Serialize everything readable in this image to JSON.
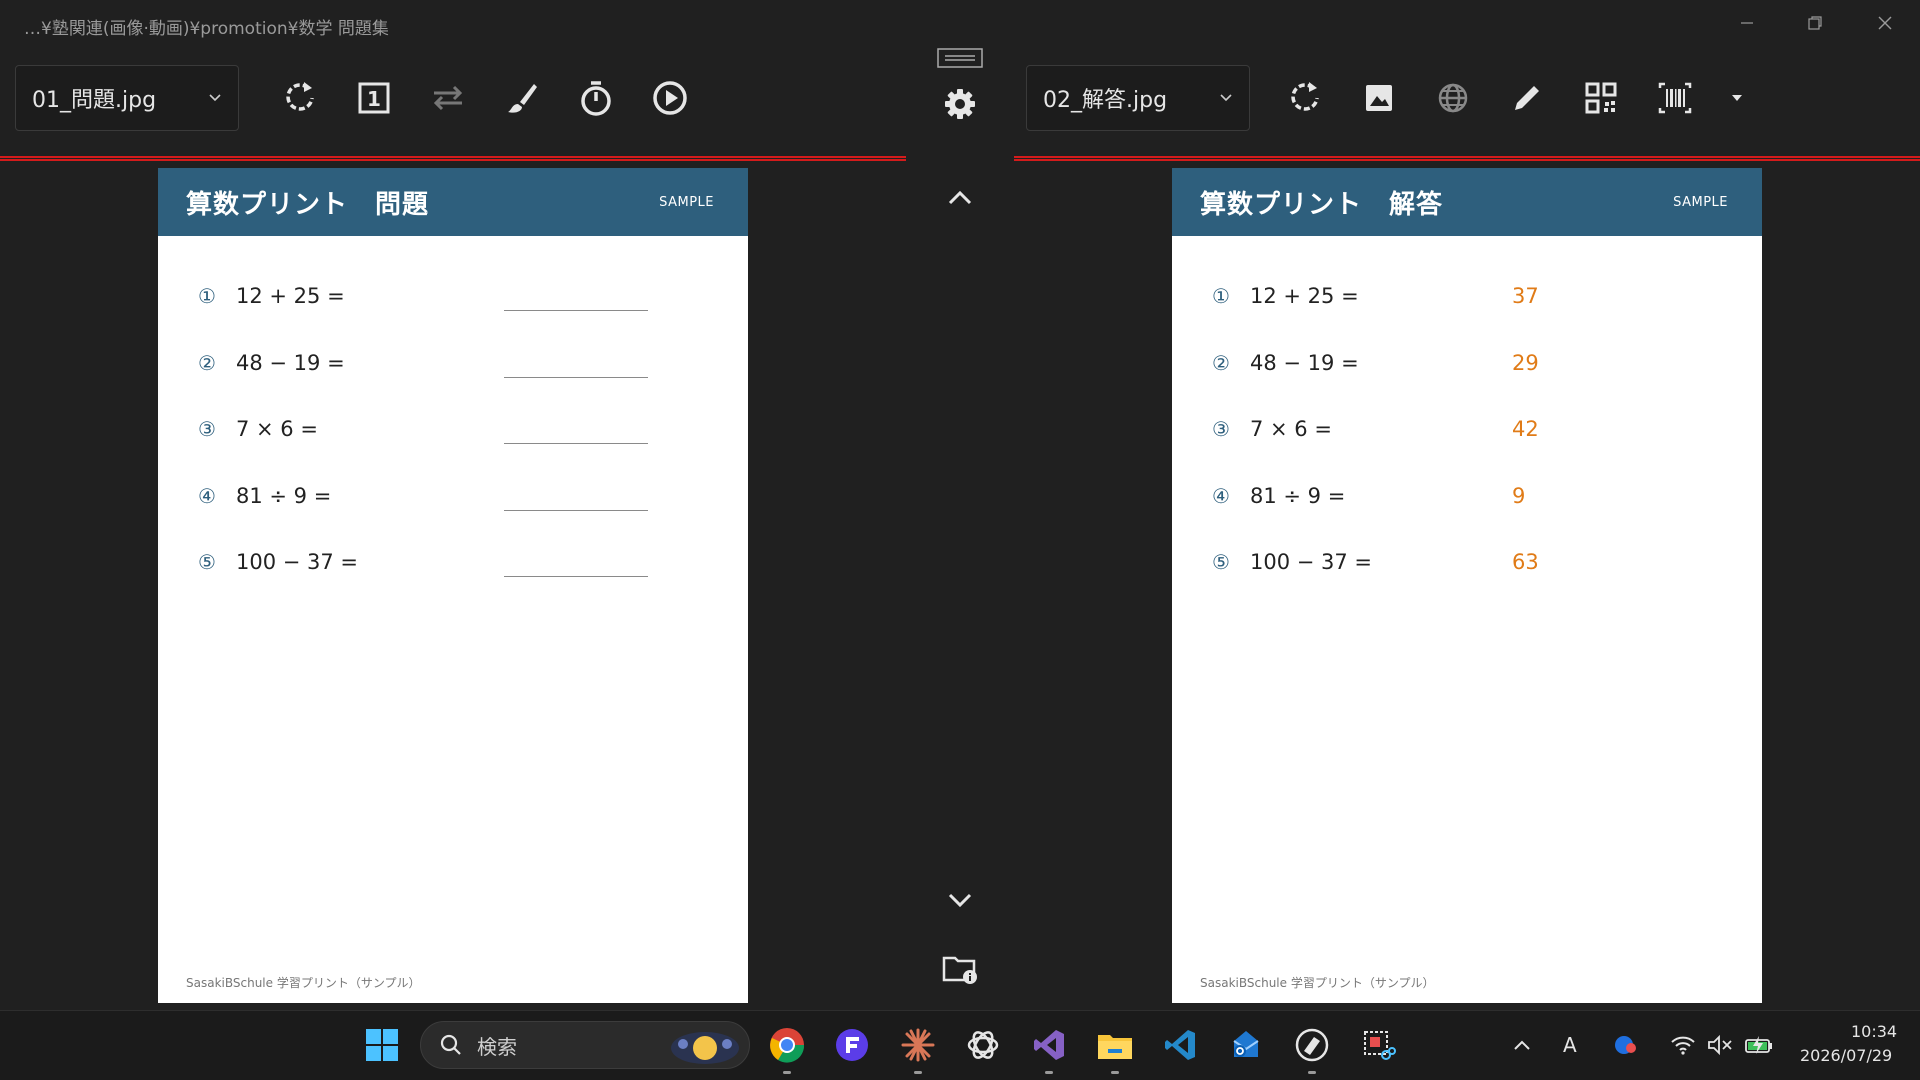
{
  "window": {
    "path": "…¥塾関連(画像·動画)¥promotion¥数学 問題集",
    "minimize_icon": "minimize-icon",
    "restore_icon": "restore-icon",
    "close_icon": "close-icon"
  },
  "left_toolbar": {
    "file": "01_問題.jpg",
    "icons": [
      "rotate-icon",
      "page-number-icon",
      "swap-icon",
      "brush-icon",
      "timer-icon",
      "play-icon"
    ]
  },
  "right_toolbar": {
    "file": "02_解答.jpg",
    "icons": [
      "rotate-icon",
      "image-icon",
      "globe-icon",
      "pencil-icon",
      "qr-code-icon",
      "barcode-icon",
      "dropdown-icon"
    ]
  },
  "left_page": {
    "title": "算数プリント　問題",
    "tag": "SAMPLE",
    "footer": "SasakiBSchule 学習プリント（サンプル）",
    "problems": [
      {
        "num": "①",
        "expr": "12 + 25 ="
      },
      {
        "num": "②",
        "expr": "48 − 19 ="
      },
      {
        "num": "③",
        "expr": "7 × 6 ="
      },
      {
        "num": "④",
        "expr": "81 ÷ 9 ="
      },
      {
        "num": "⑤",
        "expr": "100 − 37 ="
      }
    ]
  },
  "right_page": {
    "title": "算数プリント　解答",
    "tag": "SAMPLE",
    "footer": "SasakiBSchule 学習プリント（サンプル）",
    "answer_color": "#e07b17",
    "problems": [
      {
        "num": "①",
        "expr": "12 + 25 =",
        "answer": "37"
      },
      {
        "num": "②",
        "expr": "48 − 19 =",
        "answer": "29"
      },
      {
        "num": "③",
        "expr": "7 × 6 =",
        "answer": "42"
      },
      {
        "num": "④",
        "expr": "81 ÷ 9 =",
        "answer": "9"
      },
      {
        "num": "⑤",
        "expr": "100 − 37 =",
        "answer": "63"
      }
    ]
  },
  "center": {
    "icons": [
      "handle-icon",
      "gear-icon",
      "chevron-up-icon",
      "chevron-down-icon",
      "folder-info-icon"
    ]
  },
  "taskbar": {
    "search_placeholder": "検索",
    "ime": "A",
    "time": "10:34",
    "date": "2026/07/29"
  },
  "colors": {
    "accent_red": "#d41b1b",
    "header_blue": "#2e5f7d"
  }
}
